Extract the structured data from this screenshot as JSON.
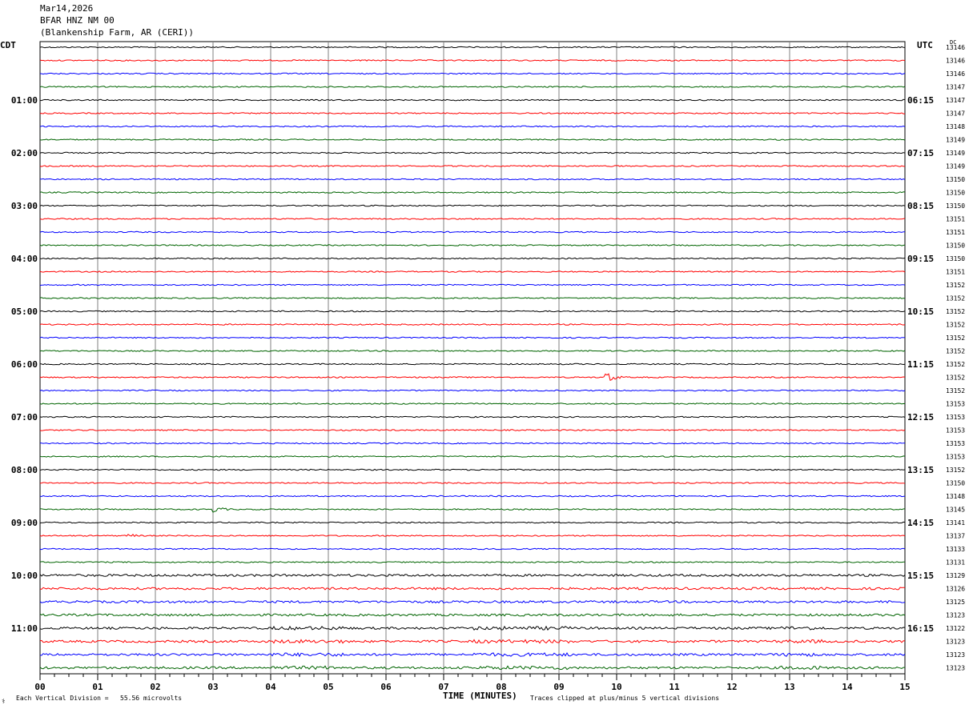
{
  "header": {
    "date": "Mar14,2026",
    "station": "BFAR HNZ NM 00",
    "location": "(Blankenship Farm, AR (CERI))"
  },
  "left_timezone": "CDT",
  "right_timezone": "UTC",
  "dc_label": "DC",
  "footer": {
    "scale_note": "Each Vertical Division =   55.56 microvolts",
    "clip_note": "Traces clipped at plus/minus 5 vertical divisions",
    "corner_mark": "⚕"
  },
  "colors": {
    "trace": [
      "#000000",
      "#ff0000",
      "#0000ff",
      "#006400"
    ],
    "grid": "#808080"
  },
  "chart_data": {
    "type": "line",
    "title": "BFAR HNZ NM 00",
    "xlabel": "TIME (MINUTES)",
    "x_ticks": [
      "00",
      "01",
      "02",
      "03",
      "04",
      "05",
      "06",
      "07",
      "08",
      "09",
      "10",
      "11",
      "12",
      "13",
      "14",
      "15"
    ],
    "xlim": [
      0,
      15
    ],
    "left_labels": [
      "",
      "",
      "",
      "",
      "01:00",
      "",
      "",
      "",
      "02:00",
      "",
      "",
      "",
      "03:00",
      "",
      "",
      "",
      "04:00",
      "",
      "",
      "",
      "05:00",
      "",
      "",
      "",
      "06:00",
      "",
      "",
      "",
      "07:00",
      "",
      "",
      "",
      "08:00",
      "",
      "",
      "",
      "09:00",
      "",
      "",
      "",
      "10:00",
      "",
      "",
      "",
      "11:00",
      "",
      "",
      ""
    ],
    "right_labels": [
      "",
      "",
      "",
      "",
      "06:15",
      "",
      "",
      "",
      "07:15",
      "",
      "",
      "",
      "08:15",
      "",
      "",
      "",
      "09:15",
      "",
      "",
      "",
      "10:15",
      "",
      "",
      "",
      "11:15",
      "",
      "",
      "",
      "12:15",
      "",
      "",
      "",
      "13:15",
      "",
      "",
      "",
      "14:15",
      "",
      "",
      "",
      "15:15",
      "",
      "",
      "",
      "16:15",
      "",
      "",
      ""
    ],
    "dc_values": [
      "13146",
      "13146",
      "13146",
      "13147",
      "13147",
      "13147",
      "13148",
      "13149",
      "13149",
      "13149",
      "13150",
      "13150",
      "13150",
      "13151",
      "13151",
      "13150",
      "13150",
      "13151",
      "13152",
      "13152",
      "13152",
      "13152",
      "13152",
      "13152",
      "13152",
      "13152",
      "13152",
      "13153",
      "13153",
      "13153",
      "13153",
      "13153",
      "13152",
      "13150",
      "13148",
      "13145",
      "13141",
      "13137",
      "13133",
      "13131",
      "13129",
      "13126",
      "13125",
      "13123",
      "13122",
      "13123",
      "13123",
      "13123"
    ],
    "events": [
      {
        "trace": 15,
        "minute": 11.6,
        "amplitude": 0.5
      },
      {
        "trace": 25,
        "minute": 9.85,
        "amplitude": 6
      },
      {
        "trace": 35,
        "minute": 3.05,
        "amplitude": 4
      },
      {
        "trace": 37,
        "minute": 1.55,
        "amplitude": 3
      }
    ]
  }
}
